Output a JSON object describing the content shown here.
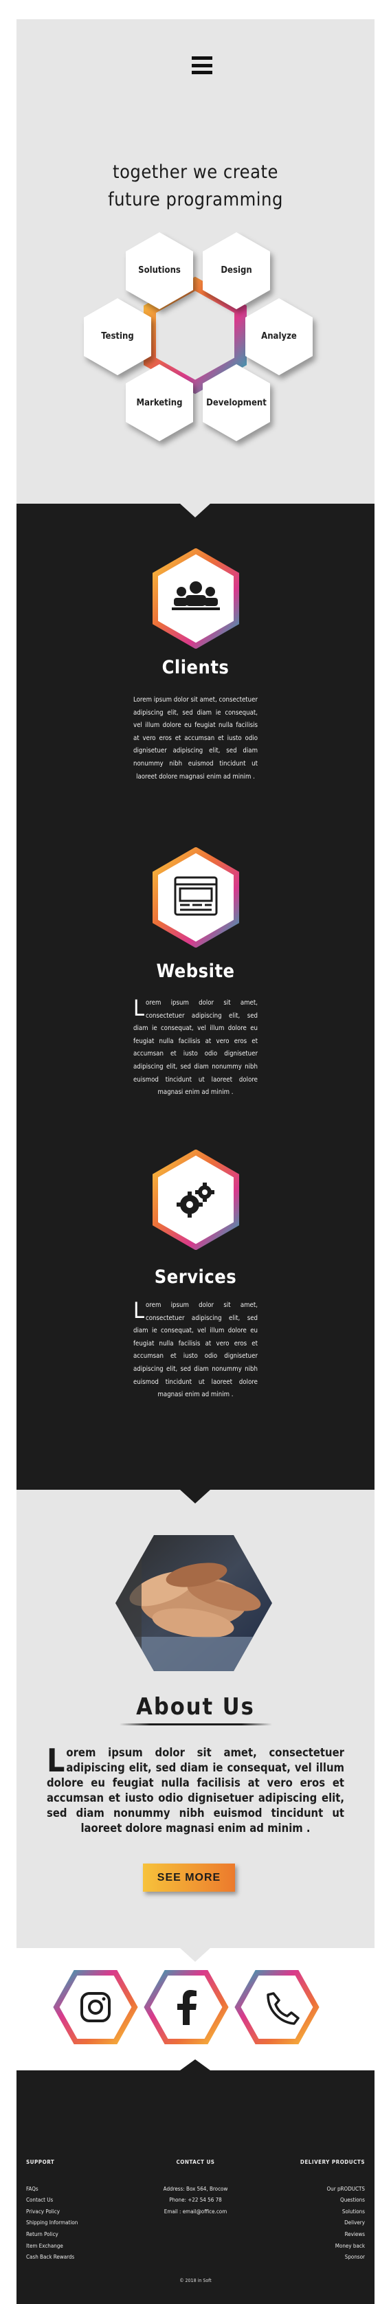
{
  "hero": {
    "title_line1": "together we create",
    "title_line2": "future programming",
    "hexes": [
      "Solutions",
      "Design",
      "Testing",
      "Analyze",
      "Marketing",
      "Development"
    ]
  },
  "features": [
    {
      "title": "Clients",
      "icon": "people-icon",
      "text": "Lorem ipsum dolor sit amet, consectetuer adipiscing elit, sed diam ie consequat, vel illum dolore eu feugiat nulla facilisis at vero eros et accumsan et iusto odio dignisetuer adipiscing elit, sed diam nonummy nibh euismod tincidunt ut laoreet dolore magnasi enim ad minim ."
    },
    {
      "title": "Website",
      "icon": "browser-window-icon",
      "dropcap": "L",
      "text": "orem ipsum dolor sit amet, consectetuer adipiscing elit, sed diam ie consequat, vel illum dolore eu feugiat nulla facilisis at vero eros et accumsan et iusto odio dignisetuer adipiscing elit, sed diam nonummy nibh euismod tincidunt ut laoreet dolore magnasi enim ad minim ."
    },
    {
      "title": "Services",
      "icon": "gears-icon",
      "dropcap": "L",
      "text": "orem ipsum dolor sit amet, consectetuer adipiscing elit, sed diam ie consequat, vel illum dolore eu feugiat nulla facilisis at vero eros et accumsan et iusto odio dignisetuer adipiscing elit, sed diam nonummy nibh euismod tincidunt ut laoreet dolore magnasi enim ad minim ."
    }
  ],
  "about": {
    "title": "About Us",
    "dropcap": "L",
    "text": "orem ipsum dolor sit amet, consectetuer adipiscing elit, sed diam ie consequat, vel illum dolore eu feugiat nulla facilisis at vero eros et accumsan et iusto odio dignisetuer adipiscing elit, sed diam nonummy nibh euismod tincidunt ut laoreet dolore magnasi enim ad minim .",
    "button": "SEE MORE"
  },
  "social": [
    "instagram-icon",
    "facebook-icon",
    "phone-icon"
  ],
  "footer": {
    "support": {
      "heading": "SUPPORT",
      "items": [
        "FAQs",
        "Contact Us",
        "Privacy Policy",
        "Shipping Information",
        "Return Policy",
        "Item Exchange",
        "Cash Back Rewards"
      ]
    },
    "contact": {
      "heading": "CONTACT US",
      "items": [
        "Address: Box 564, Brocow",
        "Phone: +22 54 56 78",
        "Email : email@office.com"
      ]
    },
    "delivery": {
      "heading": "DELIVERY PRODUCTS",
      "items": [
        "Our pRODUCTS",
        "Questions",
        "Solutions",
        "Delivery",
        "Reviews",
        "Money back",
        "Sponsor"
      ]
    },
    "copyright": "© 2018 in Soft"
  },
  "colors": {
    "dark": "#1c1c1c",
    "light": "#e6e6e6",
    "gradient": [
      "#f7c23b",
      "#ec6f3a",
      "#d83a8c",
      "#26a9b6"
    ]
  }
}
